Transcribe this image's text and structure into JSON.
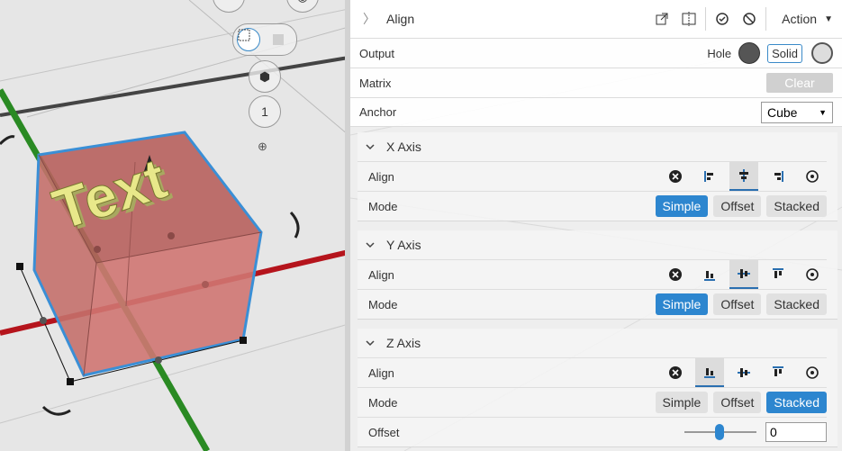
{
  "header": {
    "title": "Align",
    "action_label": "Action"
  },
  "output": {
    "label": "Output",
    "hole_label": "Hole",
    "solid_label": "Solid"
  },
  "matrix": {
    "label": "Matrix",
    "clear_label": "Clear"
  },
  "anchor": {
    "label": "Anchor",
    "value": "Cube"
  },
  "x_axis": {
    "title": "X Axis",
    "align_label": "Align",
    "mode_label": "Mode",
    "modes": [
      "Simple",
      "Offset",
      "Stacked"
    ],
    "selected_mode": "Simple"
  },
  "y_axis": {
    "title": "Y Axis",
    "align_label": "Align",
    "mode_label": "Mode",
    "modes": [
      "Simple",
      "Offset",
      "Stacked"
    ],
    "selected_mode": "Simple"
  },
  "z_axis": {
    "title": "Z Axis",
    "align_label": "Align",
    "mode_label": "Mode",
    "modes": [
      "Simple",
      "Offset",
      "Stacked"
    ],
    "selected_mode": "Stacked",
    "offset_label": "Offset",
    "offset_value": "0"
  },
  "viewport": {
    "view_count": "1",
    "model_text": "Text"
  },
  "colors": {
    "accent": "#2d86cf",
    "cube_fill": "#c86a66",
    "text_fill": "#e8e88a"
  }
}
